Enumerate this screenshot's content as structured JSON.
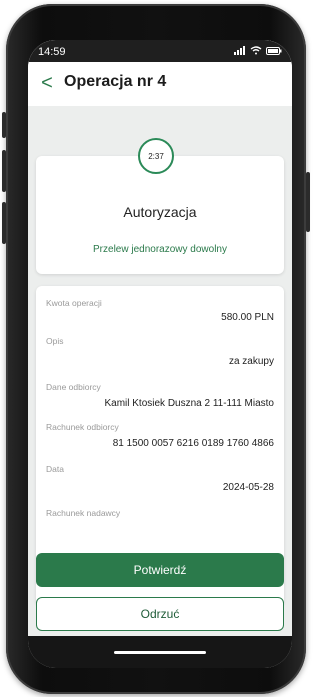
{
  "status": {
    "time": "14:59"
  },
  "header": {
    "back_label": "<",
    "title": "Operacja nr 4"
  },
  "auth": {
    "timer": "2:37",
    "title": "Autoryzacja",
    "subtitle": "Przelew jednorazowy dowolny"
  },
  "details": [
    {
      "label": "Kwota operacji",
      "value": "580.00 PLN"
    },
    {
      "label": "Opis",
      "value": "za zakupy"
    },
    {
      "label": "Dane odbiorcy",
      "value": "Kamil Ktosiek Duszna 2 11-111 Miasto"
    },
    {
      "label": "Rachunek odbiorcy",
      "value": "81 1500 0057 6216 0189 1760 4866"
    },
    {
      "label": "Data",
      "value": "2024-05-28"
    },
    {
      "label": "Rachunek nadawcy",
      "value": ""
    }
  ],
  "actions": {
    "confirm_label": "Potwierdź",
    "reject_label": "Odrzuć"
  },
  "icons": {
    "signal": "signal-icon",
    "wifi": "wifi-icon",
    "battery": "battery-icon"
  },
  "colors": {
    "accent": "#2b7a4b",
    "background": "#eceeed"
  }
}
